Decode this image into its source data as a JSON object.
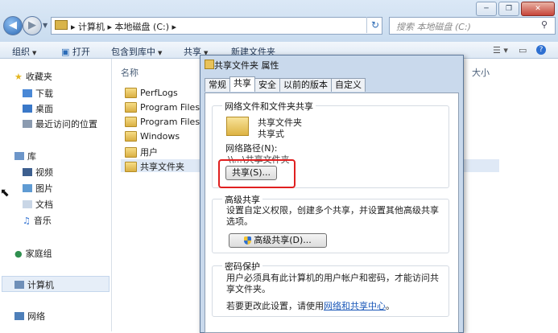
{
  "window": {
    "address_path": "▸ 计算机 ▸ 本地磁盘 (C:) ▸",
    "search_placeholder": "搜索 本地磁盘 (C:)",
    "min": "─",
    "max": "❐",
    "close": "✕"
  },
  "toolbar": {
    "organize": "组织",
    "open": "打开",
    "include_in_library": "包含到库中",
    "share": "共享",
    "new_folder": "新建文件夹"
  },
  "nav": {
    "favorites": "收藏夹",
    "favorites_items": [
      "下载",
      "桌面",
      "最近访问的位置"
    ],
    "libraries": "库",
    "library_items": [
      "视频",
      "图片",
      "文档",
      "音乐"
    ],
    "homegroup": "家庭组",
    "computer": "计算机",
    "network": "网络"
  },
  "files": {
    "col_name": "名称",
    "col_size": "大小",
    "items": [
      "PerfLogs",
      "Program Files",
      "Program Files (",
      "Windows",
      "用户",
      "共享文件夹"
    ]
  },
  "dialog": {
    "title": "共享文件夹 属性",
    "tabs": [
      "常规",
      "共享",
      "安全",
      "以前的版本",
      "自定义"
    ],
    "group1_title": "网络文件和文件夹共享",
    "folder_name": "共享文件夹",
    "folder_state": "共享式",
    "network_path_label": "网络路径(N):",
    "network_path_value": "\\\\...\\共享文件夹",
    "share_button": "共享(S)...",
    "group2_title": "高级共享",
    "group2_desc": "设置自定义权限，创建多个共享，并设置其他高级共享选项。",
    "advanced_button": "高级共享(D)...",
    "group3_title": "密码保护",
    "group3_desc": "用户必须具有此计算机的用户帐户和密码，才能访问共享文件夹。",
    "group3_link_prefix": "若要更改此设置，请使用",
    "group3_link": "网络和共享中心",
    "group3_link_suffix": "。"
  }
}
